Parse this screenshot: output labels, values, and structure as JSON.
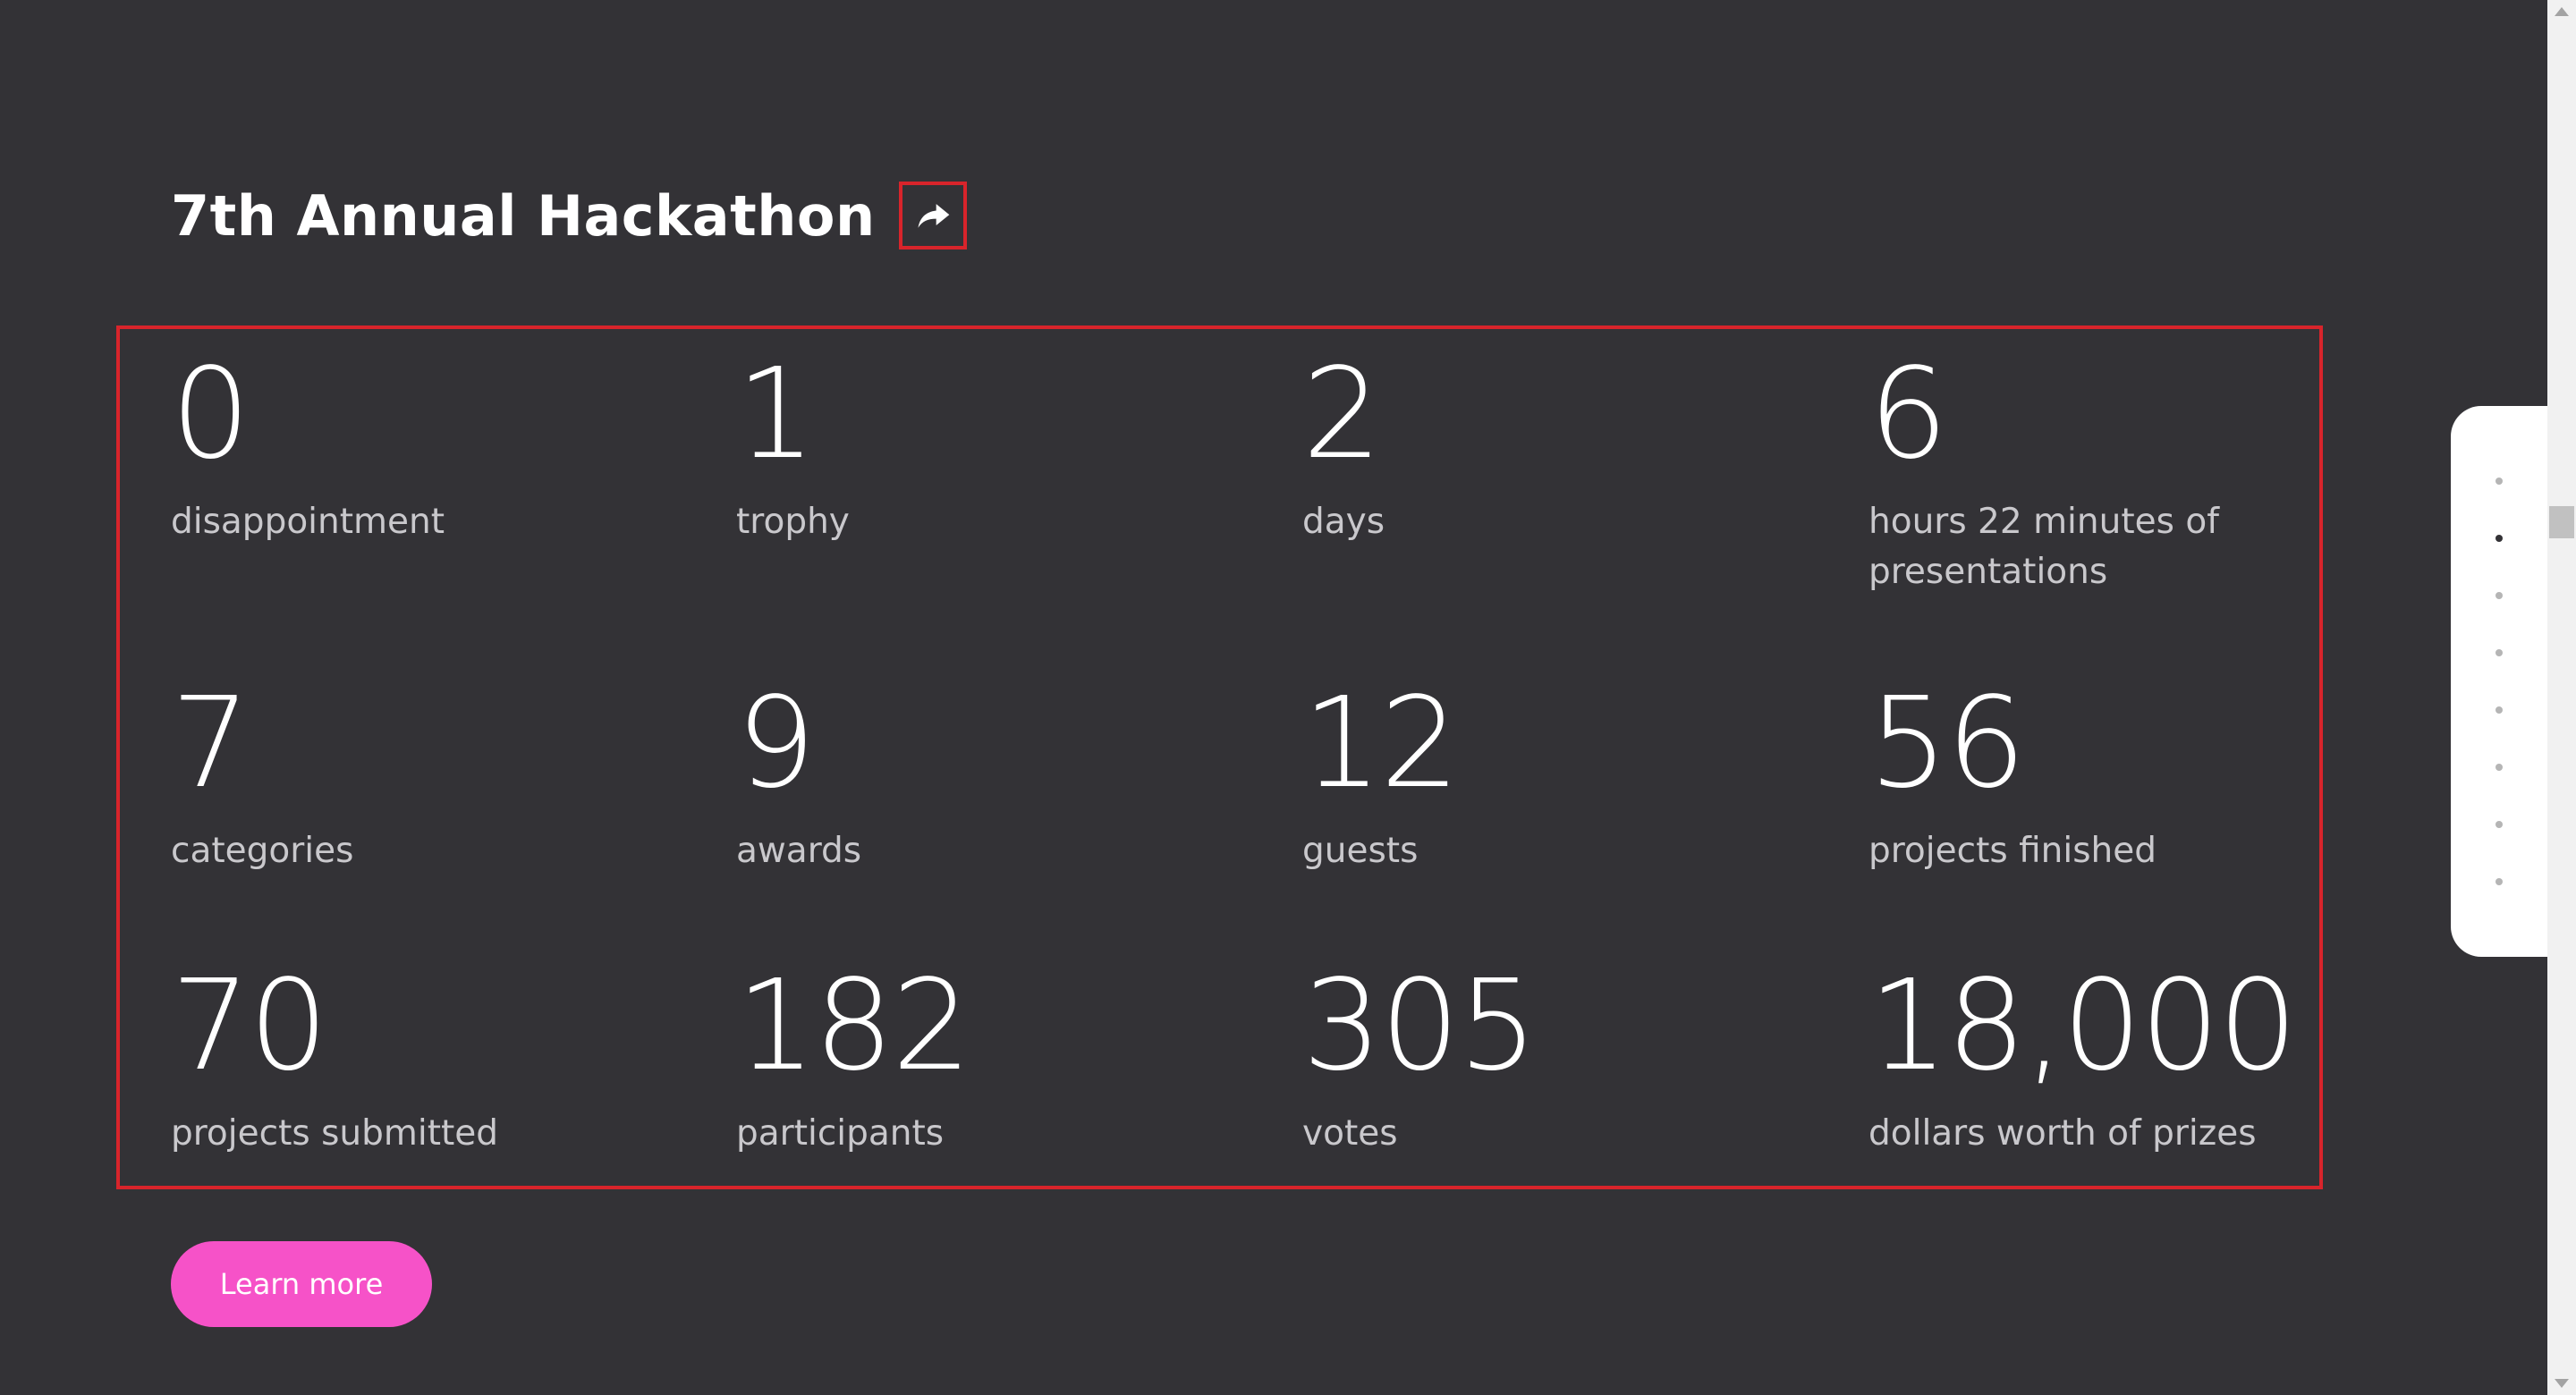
{
  "title": "7th Annual Hackathon",
  "icons": {
    "share": "share-arrow-icon"
  },
  "colors": {
    "background": "#333236",
    "accent": "#f652c8",
    "highlight_border": "#d8242b"
  },
  "stats": [
    {
      "number": "0",
      "label": "disappointment"
    },
    {
      "number": "1",
      "label": "trophy"
    },
    {
      "number": "2",
      "label": "days"
    },
    {
      "number": "6",
      "label": "hours 22 minutes of presentations"
    },
    {
      "number": "7",
      "label": "categories"
    },
    {
      "number": "9",
      "label": "awards"
    },
    {
      "number": "12",
      "label": "guests"
    },
    {
      "number": "56",
      "label": "projects finished"
    },
    {
      "number": "70",
      "label": "projects submitted"
    },
    {
      "number": "182",
      "label": "participants"
    },
    {
      "number": "305",
      "label": "votes"
    },
    {
      "number": "18,000",
      "label": "dollars worth of prizes"
    }
  ],
  "cta": {
    "label": "Learn more"
  },
  "pagination": {
    "total": 8,
    "active_index": 1
  }
}
